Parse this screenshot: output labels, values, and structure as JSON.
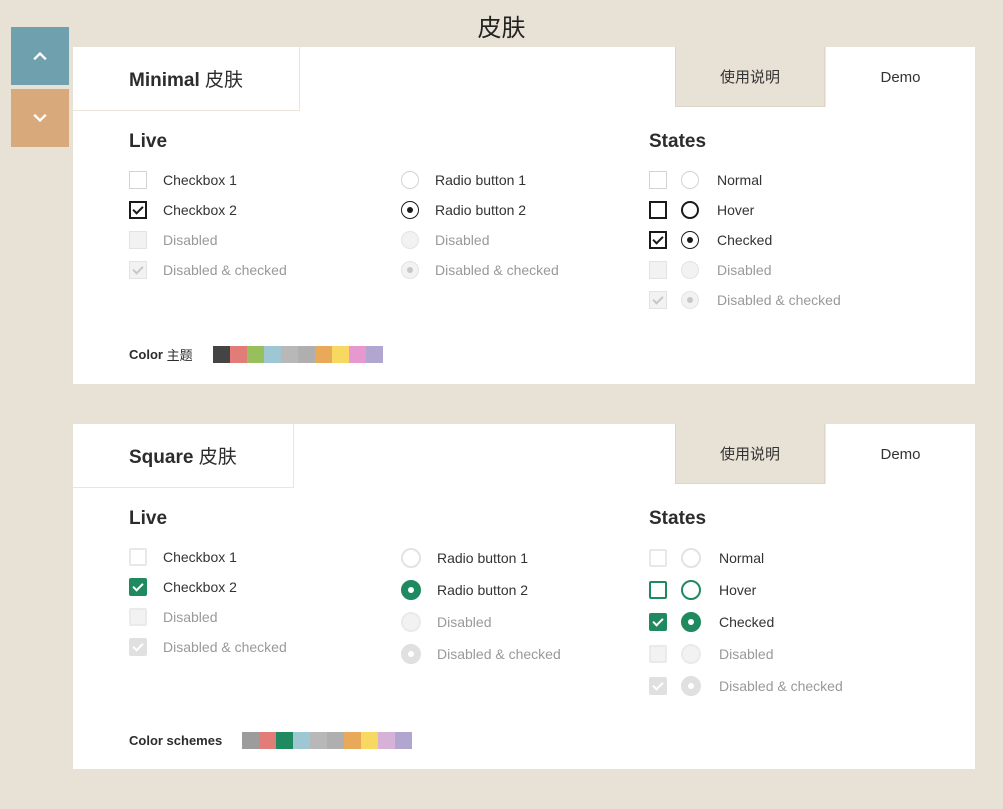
{
  "page_title": "皮肤",
  "tabs": {
    "usage": "使用说明",
    "demo": "Demo"
  },
  "sections": {
    "live": "Live",
    "states": "States"
  },
  "state_labels": {
    "normal": "Normal",
    "hover": "Hover",
    "checked": "Checked",
    "disabled": "Disabled",
    "disabled_checked": "Disabled & checked"
  },
  "skins": {
    "minimal": {
      "name_bold": "Minimal",
      "name_thin": "皮肤",
      "color_label_bold": "Color",
      "color_label_thin": "主题",
      "live": {
        "checkboxes": [
          {
            "label": "Checkbox 1",
            "state": "normal"
          },
          {
            "label": "Checkbox 2",
            "state": "checked"
          },
          {
            "label": "Disabled",
            "state": "disabled"
          },
          {
            "label": "Disabled & checked",
            "state": "disch"
          }
        ],
        "radios": [
          {
            "label": "Radio button 1",
            "state": "normal"
          },
          {
            "label": "Radio button 2",
            "state": "checked"
          },
          {
            "label": "Disabled",
            "state": "disabled"
          },
          {
            "label": "Disabled & checked",
            "state": "disch"
          }
        ]
      },
      "colors": [
        "#444444",
        "#e27c79",
        "#97c05c",
        "#9fc6d3",
        "#b8b8b8",
        "#afafaf",
        "#e8a95b",
        "#f7d861",
        "#e799cf",
        "#b1a6cf"
      ]
    },
    "square": {
      "name_bold": "Square",
      "name_thin": "皮肤",
      "color_label_bold": "Color schemes",
      "color_label_thin": "",
      "live": {
        "checkboxes": [
          {
            "label": "Checkbox 1",
            "state": "normal"
          },
          {
            "label": "Checkbox 2",
            "state": "checked"
          },
          {
            "label": "Disabled",
            "state": "disabled"
          },
          {
            "label": "Disabled & checked",
            "state": "disch"
          }
        ],
        "radios": [
          {
            "label": "Radio button 1",
            "state": "normal"
          },
          {
            "label": "Radio button 2",
            "state": "checked"
          },
          {
            "label": "Disabled",
            "state": "disabled"
          },
          {
            "label": "Disabled & checked",
            "state": "disch"
          }
        ]
      },
      "colors": [
        "#9c9c9c",
        "#e27c79",
        "#1f8a5f",
        "#9fc6d3",
        "#b8b8b8",
        "#afafaf",
        "#e8a95b",
        "#f7d861",
        "#d5b2d6",
        "#b1a6cf"
      ]
    }
  }
}
